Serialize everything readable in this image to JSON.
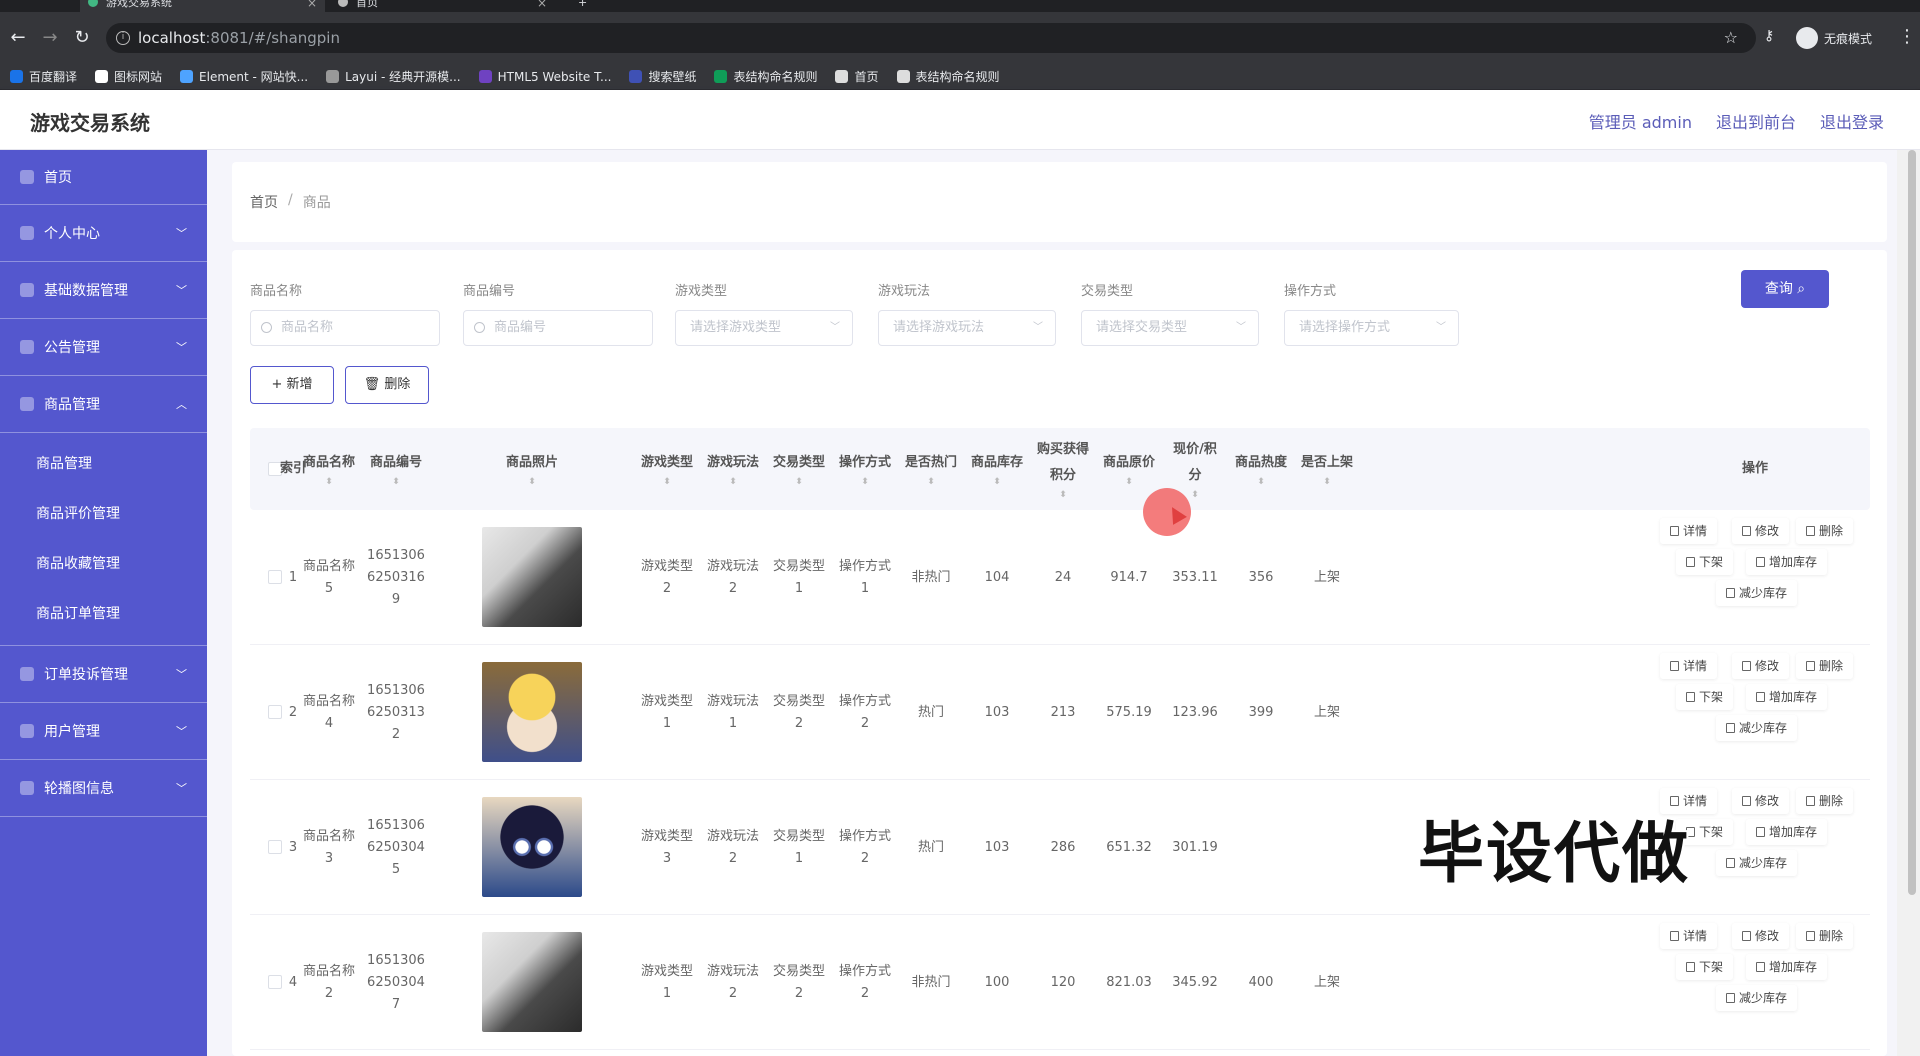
{
  "browser": {
    "tabs": [
      {
        "title": "游戏交易系统",
        "active": true
      },
      {
        "title": "首页",
        "active": false
      }
    ],
    "url_host": "localhost",
    "url_path": ":8081/#/shangpin",
    "incognito_label": "无痕模式",
    "bookmarks": [
      "百度翻译",
      "图标网站",
      "Element - 网站快...",
      "Layui - 经典开源模...",
      "HTML5 Website T...",
      "搜索壁纸",
      "表结构命名规则",
      "首页",
      "表结构命名规则"
    ],
    "bookmark_colors": [
      "#1a73e8",
      "#ffffff",
      "#4ea3ff",
      "#999999",
      "#6f42c1",
      "#3f51b5",
      "#0f9d58",
      "#dddddd",
      "#dddddd"
    ]
  },
  "header": {
    "title": "游戏交易系统",
    "links": [
      "管理员 admin",
      "退出到前台",
      "退出登录"
    ]
  },
  "sidebar": {
    "items": [
      {
        "label": "首页",
        "icon": "home-icon",
        "expandable": false
      },
      {
        "label": "个人中心",
        "icon": "user-icon",
        "expandable": true
      },
      {
        "label": "基础数据管理",
        "icon": "folder-icon",
        "expandable": true
      },
      {
        "label": "公告管理",
        "icon": "notice-icon",
        "expandable": true
      },
      {
        "label": "商品管理",
        "icon": "box-icon",
        "expandable": true,
        "expanded": true,
        "children": [
          "商品管理",
          "商品评价管理",
          "商品收藏管理",
          "商品订单管理"
        ]
      },
      {
        "label": "订单投诉管理",
        "icon": "send-icon",
        "expandable": true
      },
      {
        "label": "用户管理",
        "icon": "clock-icon",
        "expandable": true
      },
      {
        "label": "轮播图信息",
        "icon": "image-icon",
        "expandable": true
      }
    ]
  },
  "breadcrumb": {
    "home": "首页",
    "sep": "/",
    "current": "商品"
  },
  "filters": [
    {
      "label": "商品名称",
      "placeholder": "商品名称",
      "type": "input"
    },
    {
      "label": "商品编号",
      "placeholder": "商品编号",
      "type": "input"
    },
    {
      "label": "游戏类型",
      "placeholder": "请选择游戏类型",
      "type": "select"
    },
    {
      "label": "游戏玩法",
      "placeholder": "请选择游戏玩法",
      "type": "select"
    },
    {
      "label": "交易类型",
      "placeholder": "请选择交易类型",
      "type": "select"
    },
    {
      "label": "操作方式",
      "placeholder": "请选择操作方式",
      "type": "select"
    }
  ],
  "buttons": {
    "query": "查询",
    "add": "+ 新增",
    "delete": "删除"
  },
  "table": {
    "headers": [
      "索引",
      "商品名称",
      "商品编号",
      "商品照片",
      "游戏类型",
      "游戏玩法",
      "交易类型",
      "操作方式",
      "是否热门",
      "商品库存",
      "购买获得积分",
      "商品原价",
      "现价/积分",
      "商品热度",
      "是否上架",
      "操作"
    ],
    "rows": [
      {
        "index": "1",
        "name": "商品名称5",
        "code": "16513066250316 9",
        "photo": "silhouette",
        "game_type": "游戏类型2",
        "play": "游戏玩法2",
        "trade": "交易类型1",
        "operate": "操作方式1",
        "hot": "非热门",
        "stock": "104",
        "points": "24",
        "price": "914.7",
        "now": "353.11",
        "heat": "356",
        "onsale": "上架"
      },
      {
        "index": "2",
        "name": "商品名称4",
        "code": "16513066250313 2",
        "photo": "yellow",
        "game_type": "游戏类型1",
        "play": "游戏玩法1",
        "trade": "交易类型2",
        "operate": "操作方式2",
        "hot": "热门",
        "stock": "103",
        "points": "213",
        "price": "575.19",
        "now": "123.96",
        "heat": "399",
        "onsale": "上架"
      },
      {
        "index": "3",
        "name": "商品名称3",
        "code": "16513066250304 5",
        "photo": "conan",
        "game_type": "游戏类型3",
        "play": "游戏玩法2",
        "trade": "交易类型1",
        "operate": "操作方式2",
        "hot": "热门",
        "stock": "103",
        "points": "286",
        "price": "651.32",
        "now": "301.19",
        "heat": "",
        "onsale": ""
      },
      {
        "index": "4",
        "name": "商品名称2",
        "code": "16513066250304 7",
        "photo": "silhouette",
        "game_type": "游戏类型1",
        "play": "游戏玩法2",
        "trade": "交易类型2",
        "operate": "操作方式2",
        "hot": "非热门",
        "stock": "100",
        "points": "120",
        "price": "821.03",
        "now": "345.92",
        "heat": "400",
        "onsale": "上架"
      }
    ],
    "actions": [
      "详情",
      "修改",
      "删除",
      "下架",
      "增加库存",
      "减少库存"
    ]
  },
  "watermark": "毕设代做",
  "colors": {
    "accent": "#5457ce",
    "sidebar": "#5457ce"
  }
}
